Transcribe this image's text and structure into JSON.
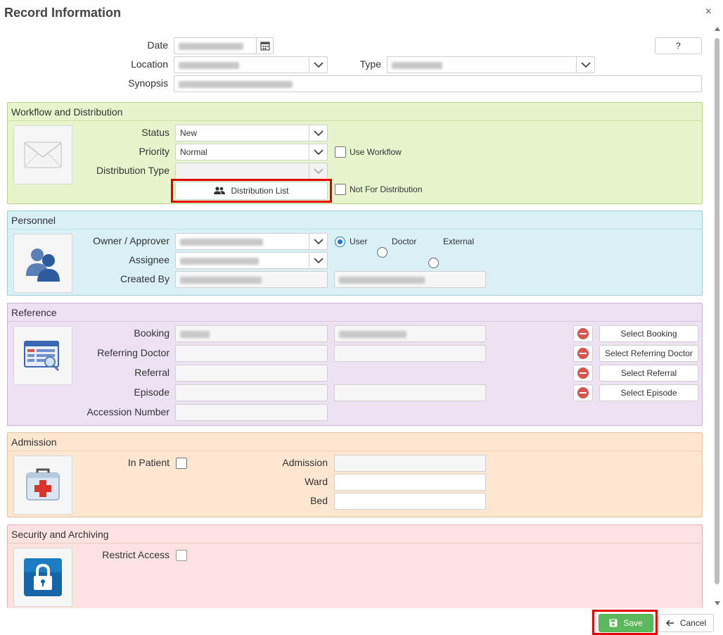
{
  "dialog": {
    "title": "Record Information",
    "close": "×"
  },
  "top": {
    "date_label": "Date",
    "location_label": "Location",
    "type_label": "Type",
    "synopsis_label": "Synopsis",
    "help_label": "?"
  },
  "workflow": {
    "title": "Workflow and Distribution",
    "status_label": "Status",
    "status_value": "New",
    "priority_label": "Priority",
    "priority_value": "Normal",
    "distribution_type_label": "Distribution Type",
    "use_workflow_label": "Use Workflow",
    "distribution_list_label": "Distribution List",
    "not_for_distribution_label": "Not For Distribution"
  },
  "personnel": {
    "title": "Personnel",
    "owner_label": "Owner / Approver",
    "assignee_label": "Assignee",
    "created_by_label": "Created By",
    "radio_user": "User",
    "radio_doctor": "Doctor",
    "radio_external": "External"
  },
  "reference": {
    "title": "Reference",
    "booking_label": "Booking",
    "referring_doctor_label": "Referring Doctor",
    "referral_label": "Referral",
    "episode_label": "Episode",
    "accession_label": "Accession Number",
    "select_booking": "Select Booking",
    "select_referring_doctor": "Select Referring Doctor",
    "select_referral": "Select Referral",
    "select_episode": "Select Episode"
  },
  "admission": {
    "title": "Admission",
    "in_patient_label": "In Patient",
    "admission_label": "Admission",
    "ward_label": "Ward",
    "bed_label": "Bed"
  },
  "security": {
    "title": "Security and Archiving",
    "restrict_label": "Restrict Access"
  },
  "footer": {
    "save_label": "Save",
    "cancel_label": "Cancel"
  },
  "colors": {
    "workflow_bg": "#e8f5cc",
    "workflow_border": "#b9d98a",
    "personnel_bg": "#d9f0f5",
    "personnel_border": "#9fd0dc",
    "reference_bg": "#ede2f1",
    "reference_border": "#cbb5d4",
    "admission_bg": "#fde7d1",
    "admission_border": "#e8c49f",
    "security_bg": "#fde2e2",
    "security_border": "#e6b3b3",
    "save_green": "#5cb85c",
    "highlight_red": "#e00000"
  }
}
